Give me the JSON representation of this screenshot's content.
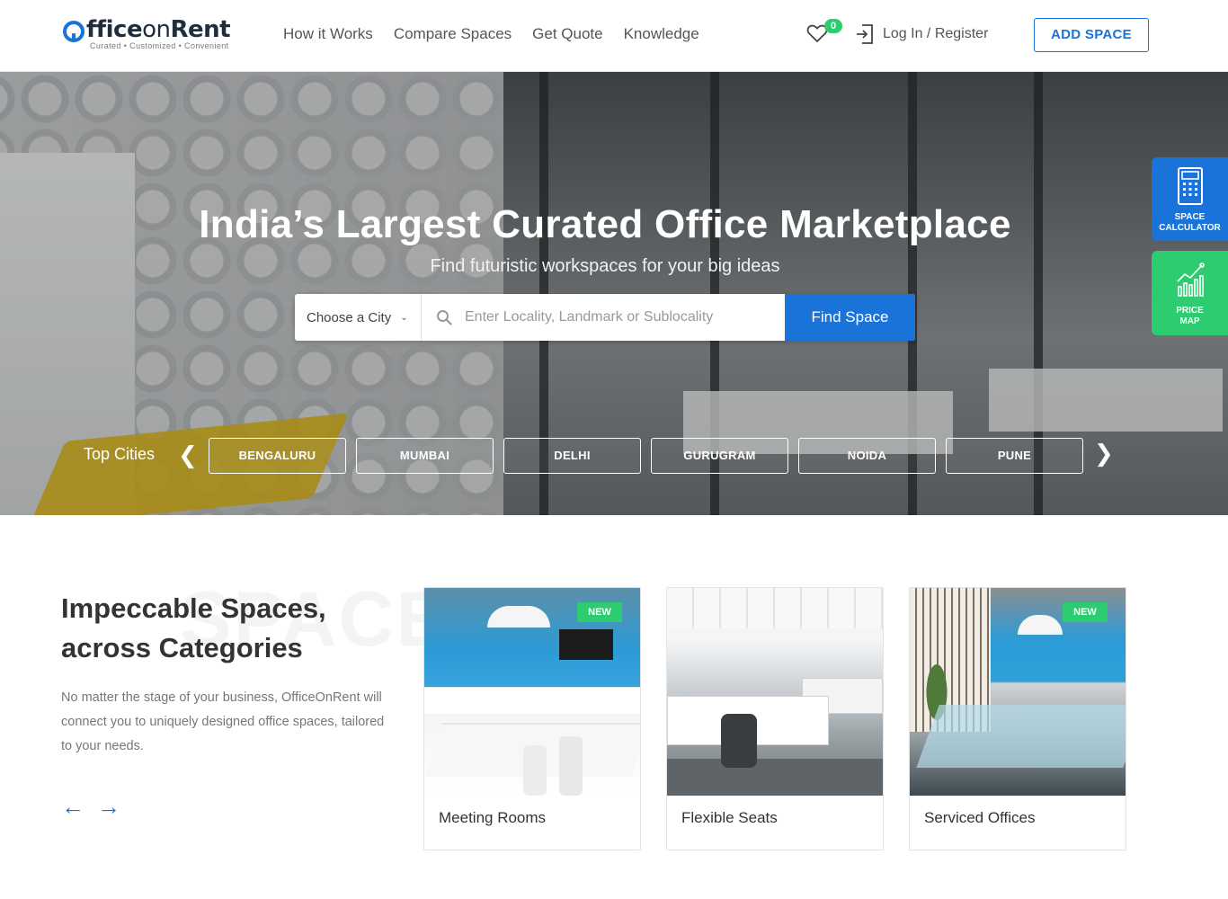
{
  "header": {
    "logo": {
      "word_a": "ffice",
      "word_b": "on",
      "word_c": "Rent",
      "tagline": "Curated • Customized • Convenient"
    },
    "nav": [
      "How it Works",
      "Compare Spaces",
      "Get Quote",
      "Knowledge"
    ],
    "wishlist_count": "0",
    "login_label": "Log In / Register",
    "add_space_label": "ADD SPACE"
  },
  "hero": {
    "title": "India’s Largest Curated Office Marketplace",
    "subtitle": "Find futuristic workspaces for your big ideas",
    "search": {
      "city_label": "Choose a City",
      "locality_placeholder": "Enter Locality, Landmark or Sublocality",
      "find_label": "Find Space"
    },
    "top_cities_label": "Top Cities",
    "cities": [
      "BENGALURU",
      "MUMBAI",
      "DELHI",
      "GURUGRAM",
      "NOIDA",
      "PUNE"
    ]
  },
  "side_widgets": {
    "calculator_label": "SPACE\nCALCULATOR",
    "price_map_label": "PRICE\nMAP"
  },
  "categories": {
    "background_word": "SPACES",
    "title": "Impeccable Spaces, across Categories",
    "description": "No matter the stage of your business, OfficeOnRent will connect you to uniquely designed office spaces, tailored to your needs.",
    "cards": [
      {
        "name": "Meeting Rooms",
        "badge": "NEW"
      },
      {
        "name": "Flexible Seats",
        "badge": ""
      },
      {
        "name": "Serviced Offices",
        "badge": "NEW"
      }
    ]
  },
  "colors": {
    "brand_blue": "#1a73d9",
    "accent_green": "#2ecc71"
  },
  "icons": [
    "heart-icon",
    "login-icon",
    "search-icon",
    "chevron-down-icon",
    "chevron-left-icon",
    "chevron-right-icon",
    "calculator-icon",
    "price-chart-icon",
    "arrow-left-icon",
    "arrow-right-icon"
  ]
}
